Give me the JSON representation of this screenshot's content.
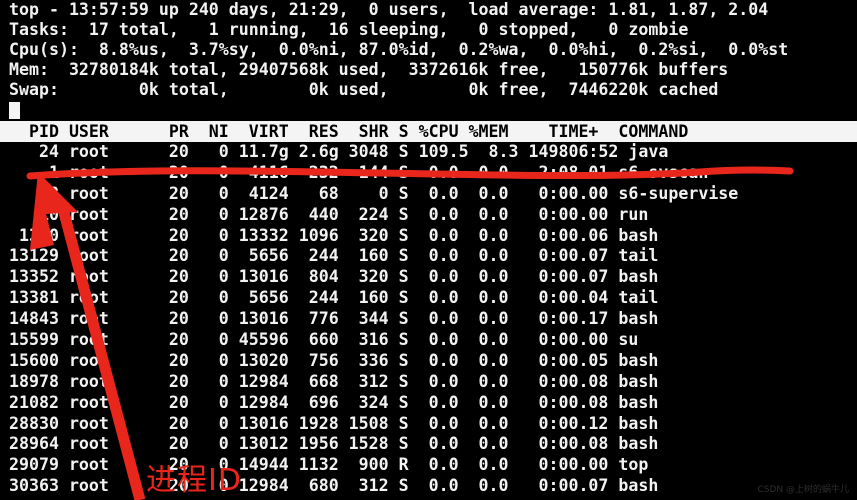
{
  "terminal": {
    "summary": {
      "uptime_line": "top - 13:57:59 up 240 days, 21:29,  0 users,  load average: 1.81, 1.87, 2.04",
      "tasks_line": "Tasks:  17 total,   1 running,  16 sleeping,   0 stopped,   0 zombie",
      "cpu_line": "Cpu(s):  8.8%us,  3.7%sy,  0.0%ni, 87.0%id,  0.2%wa,  0.0%hi,  0.2%si,  0.0%st",
      "mem_line": "Mem:  32780184k total, 29407568k used,  3372616k free,   150776k buffers",
      "swap_line": "Swap:        0k total,        0k used,        0k free,  7446220k cached",
      "parsed": {
        "time": "13:57:59",
        "up": "240 days, 21:29",
        "users": "0",
        "load_average": [
          "1.81",
          "1.87",
          "2.04"
        ],
        "tasks": {
          "total": "17",
          "running": "1",
          "sleeping": "16",
          "stopped": "0",
          "zombie": "0"
        },
        "cpu": {
          "us": "8.8",
          "sy": "3.7",
          "ni": "0.0",
          "id": "87.0",
          "wa": "0.2",
          "hi": "0.0",
          "si": "0.2",
          "st": "0.0"
        },
        "mem": {
          "total": "32780184k",
          "used": "29407568k",
          "free": "3372616k",
          "buffers": "150776k"
        },
        "swap": {
          "total": "0k",
          "used": "0k",
          "free": "0k",
          "cached": "7446220k"
        }
      }
    },
    "column_header": "  PID USER      PR  NI  VIRT  RES  SHR S %CPU %MEM    TIME+  COMMAND",
    "columns": [
      "PID",
      "USER",
      "PR",
      "NI",
      "VIRT",
      "RES",
      "SHR",
      "S",
      "%CPU",
      "%MEM",
      "TIME+",
      "COMMAND"
    ],
    "rows": [
      {
        "line": "   24 root      20   0 11.7g 2.6g 3048 S 109.5  8.3 149806:52 java",
        "pid": "24",
        "user": "root",
        "pr": "20",
        "ni": "0",
        "virt": "11.7g",
        "res": "2.6g",
        "shr": "3048",
        "s": "S",
        "cpu": "109.5",
        "mem": "8.3",
        "time": "149806:52",
        "command": "java"
      },
      {
        "line": "    1 root      20   0  4116  232  144 S  0.0  0.0   2:08.01 s6-svscan",
        "pid": "1",
        "user": "root",
        "pr": "20",
        "ni": "0",
        "virt": "4116",
        "res": "232",
        "shr": "144",
        "s": "S",
        "cpu": "0.0",
        "mem": "0.0",
        "time": "2:08.01",
        "command": "s6-svscan"
      },
      {
        "line": "    8 root      20   0  4124   68    0 S  0.0  0.0   0:00.00 s6-supervise",
        "pid": "8",
        "user": "root",
        "pr": "20",
        "ni": "0",
        "virt": "4124",
        "res": "68",
        "shr": "0",
        "s": "S",
        "cpu": "0.0",
        "mem": "0.0",
        "time": "0:00.00",
        "command": "s6-supervise"
      },
      {
        "line": "   10 root      20   0 12876  440  224 S  0.0  0.0   0:00.00 run",
        "pid": "10",
        "user": "root",
        "pr": "20",
        "ni": "0",
        "virt": "12876",
        "res": "440",
        "shr": "224",
        "s": "S",
        "cpu": "0.0",
        "mem": "0.0",
        "time": "0:00.00",
        "command": "run"
      },
      {
        "line": " 1310 root      20   0 13332 1096  320 S  0.0  0.0   0:00.06 bash",
        "pid": "1310",
        "user": "root",
        "pr": "20",
        "ni": "0",
        "virt": "13332",
        "res": "1096",
        "shr": "320",
        "s": "S",
        "cpu": "0.0",
        "mem": "0.0",
        "time": "0:00.06",
        "command": "bash"
      },
      {
        "line": "13129 root      20   0  5656  244  160 S  0.0  0.0   0:00.07 tail",
        "pid": "13129",
        "user": "root",
        "pr": "20",
        "ni": "0",
        "virt": "5656",
        "res": "244",
        "shr": "160",
        "s": "S",
        "cpu": "0.0",
        "mem": "0.0",
        "time": "0:00.07",
        "command": "tail"
      },
      {
        "line": "13352 root      20   0 13016  804  320 S  0.0  0.0   0:00.07 bash",
        "pid": "13352",
        "user": "root",
        "pr": "20",
        "ni": "0",
        "virt": "13016",
        "res": "804",
        "shr": "320",
        "s": "S",
        "cpu": "0.0",
        "mem": "0.0",
        "time": "0:00.07",
        "command": "bash"
      },
      {
        "line": "13381 root      20   0  5656  244  160 S  0.0  0.0   0:00.04 tail",
        "pid": "13381",
        "user": "root",
        "pr": "20",
        "ni": "0",
        "virt": "5656",
        "res": "244",
        "shr": "160",
        "s": "S",
        "cpu": "0.0",
        "mem": "0.0",
        "time": "0:00.04",
        "command": "tail"
      },
      {
        "line": "14843 root      20   0 13016  776  344 S  0.0  0.0   0:00.17 bash",
        "pid": "14843",
        "user": "root",
        "pr": "20",
        "ni": "0",
        "virt": "13016",
        "res": "776",
        "shr": "344",
        "s": "S",
        "cpu": "0.0",
        "mem": "0.0",
        "time": "0:00.17",
        "command": "bash"
      },
      {
        "line": "15599 root      20   0 45596  660  316 S  0.0  0.0   0:00.00 su",
        "pid": "15599",
        "user": "root",
        "pr": "20",
        "ni": "0",
        "virt": "45596",
        "res": "660",
        "shr": "316",
        "s": "S",
        "cpu": "0.0",
        "mem": "0.0",
        "time": "0:00.00",
        "command": "su"
      },
      {
        "line": "15600 root      20   0 13020  756  336 S  0.0  0.0   0:00.05 bash",
        "pid": "15600",
        "user": "root",
        "pr": "20",
        "ni": "0",
        "virt": "13020",
        "res": "756",
        "shr": "336",
        "s": "S",
        "cpu": "0.0",
        "mem": "0.0",
        "time": "0:00.05",
        "command": "bash"
      },
      {
        "line": "18978 root      20   0 12984  668  312 S  0.0  0.0   0:00.08 bash",
        "pid": "18978",
        "user": "root",
        "pr": "20",
        "ni": "0",
        "virt": "12984",
        "res": "668",
        "shr": "312",
        "s": "S",
        "cpu": "0.0",
        "mem": "0.0",
        "time": "0:00.08",
        "command": "bash"
      },
      {
        "line": "21082 root      20   0 12984  696  324 S  0.0  0.0   0:00.08 bash",
        "pid": "21082",
        "user": "root",
        "pr": "20",
        "ni": "0",
        "virt": "12984",
        "res": "696",
        "shr": "324",
        "s": "S",
        "cpu": "0.0",
        "mem": "0.0",
        "time": "0:00.08",
        "command": "bash"
      },
      {
        "line": "28830 root      20   0 13016 1928 1508 S  0.0  0.0   0:00.12 bash",
        "pid": "28830",
        "user": "root",
        "pr": "20",
        "ni": "0",
        "virt": "13016",
        "res": "1928",
        "shr": "1508",
        "s": "S",
        "cpu": "0.0",
        "mem": "0.0",
        "time": "0:00.12",
        "command": "bash"
      },
      {
        "line": "28964 root      20   0 13012 1956 1528 S  0.0  0.0   0:00.08 bash",
        "pid": "28964",
        "user": "root",
        "pr": "20",
        "ni": "0",
        "virt": "13012",
        "res": "1956",
        "shr": "1528",
        "s": "S",
        "cpu": "0.0",
        "mem": "0.0",
        "time": "0:00.08",
        "command": "bash"
      },
      {
        "line": "29079 root      20   0 14944 1132  900 R  0.0  0.0   0:00.00 top",
        "pid": "29079",
        "user": "root",
        "pr": "20",
        "ni": "0",
        "virt": "14944",
        "res": "1132",
        "shr": "900",
        "s": "R",
        "cpu": "0.0",
        "mem": "0.0",
        "time": "0:00.00",
        "command": "top"
      },
      {
        "line": "30363 root      20   0 12984  680  312 S  0.0  0.0   0:00.07 bash",
        "pid": "30363",
        "user": "root",
        "pr": "20",
        "ni": "0",
        "virt": "12984",
        "res": "680",
        "shr": "312",
        "s": "S",
        "cpu": "0.0",
        "mem": "0.0",
        "time": "0:00.07",
        "command": "bash"
      }
    ]
  },
  "annotation": {
    "label": "进程ID",
    "color": "#e8261c",
    "underline_target_row": "java",
    "arrow_points_to": "PID"
  },
  "watermark": {
    "text": "CSDN @上树的蜗牛儿"
  }
}
